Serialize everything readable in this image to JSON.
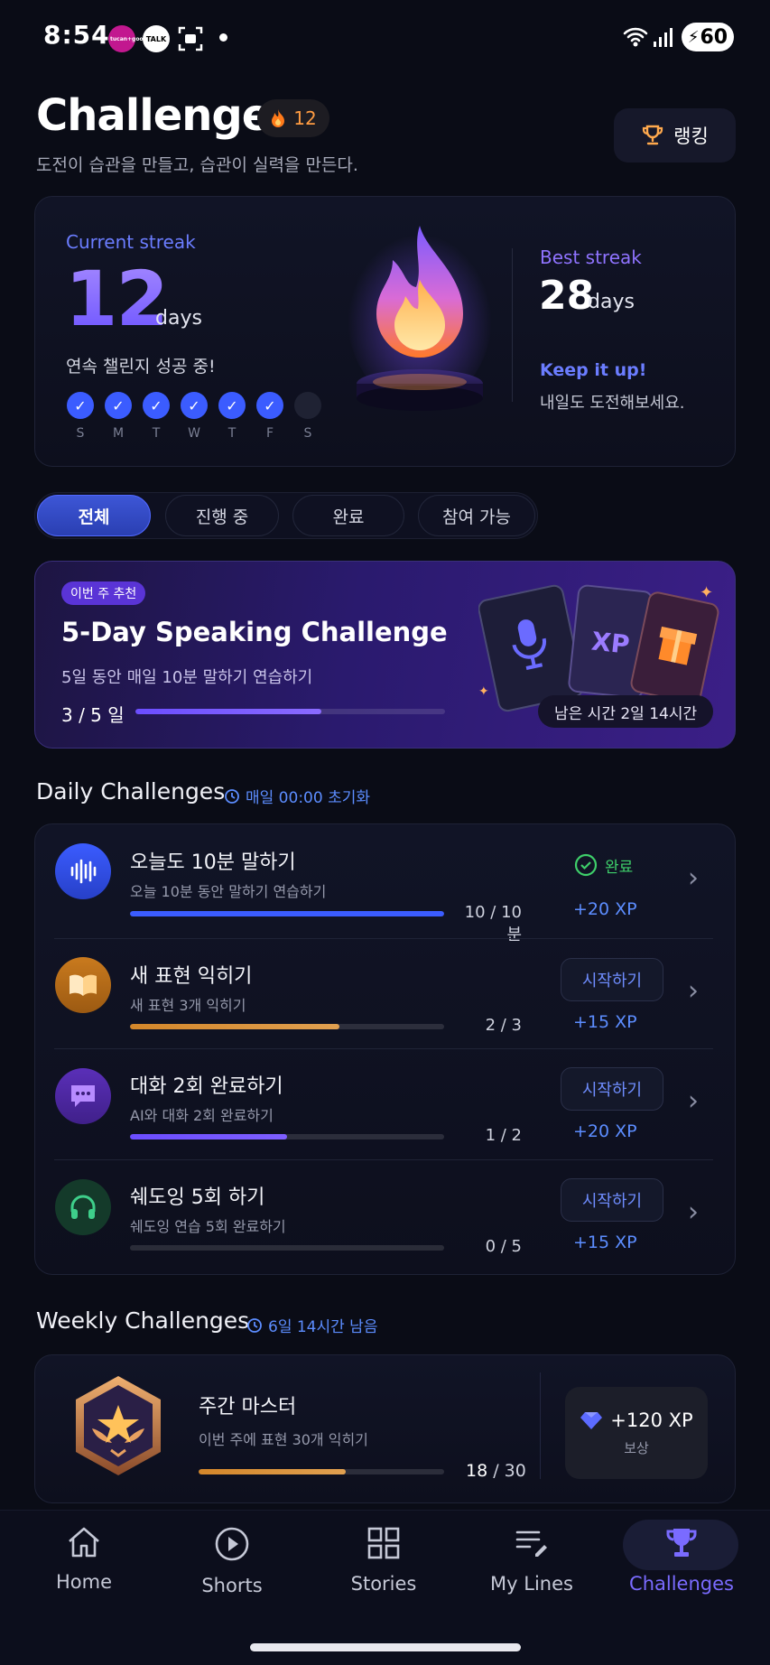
{
  "status_bar": {
    "time": "8:54",
    "apps": [
      "tucan+good",
      "TALK"
    ],
    "battery": "60"
  },
  "header": {
    "title": "Challenges",
    "streak_chip": "12",
    "subtitle": "도전이 습관을 만들고, 습관이 실력을 만든다.",
    "ranking_label": "랭킹"
  },
  "streak": {
    "current_label": "Current streak",
    "current_value": "12",
    "days_unit": "days",
    "current_sub": "연속 챌린지 성공 중!",
    "week": [
      {
        "letter": "S",
        "done": true
      },
      {
        "letter": "M",
        "done": true
      },
      {
        "letter": "T",
        "done": true
      },
      {
        "letter": "W",
        "done": true
      },
      {
        "letter": "T",
        "done": true
      },
      {
        "letter": "F",
        "done": true
      },
      {
        "letter": "S",
        "done": false
      }
    ],
    "best_label": "Best streak",
    "best_value": "28",
    "keep_title": "Keep it up!",
    "keep_sub": "내일도 도전해보세요."
  },
  "tabs": [
    "전체",
    "진행 중",
    "완료",
    "참여 가능"
  ],
  "featured": {
    "badge": "이번 주 추천",
    "title": "5-Day Speaking Challenge",
    "subtitle": "5일 동안 매일 10분 말하기 연습하기",
    "progress_label": "3 / 5 일",
    "progress": 0.6,
    "remaining": "남은 시간 2일 14시간",
    "card_xp": "XP"
  },
  "daily": {
    "title": "Daily Challenges",
    "reset_note": "매일 00:00 초기화",
    "items": [
      {
        "title": "오늘도 10분 말하기",
        "sub": "오늘 10분 동안 말하기 연습하기",
        "count": "10 / 10 분",
        "progress": 1.0,
        "status": "완료",
        "xp": "+20 XP"
      },
      {
        "title": "새 표현 익히기",
        "sub": "새 표현 3개 익히기",
        "count": "2 / 3",
        "progress": 0.6667,
        "action": "시작하기",
        "xp": "+15 XP"
      },
      {
        "title": "대화 2회 완료하기",
        "sub": "AI와 대화 2회 완료하기",
        "count": "1 / 2",
        "progress": 0.5,
        "action": "시작하기",
        "xp": "+20 XP"
      },
      {
        "title": "쉐도잉 5회 하기",
        "sub": "쉐도잉 연습 5회 완료하기",
        "count": "0 / 5",
        "progress": 0.0,
        "action": "시작하기",
        "xp": "+15 XP"
      }
    ]
  },
  "weekly": {
    "title": "Weekly Challenges",
    "remaining_note": "6일 14시간 남음",
    "item": {
      "title": "주간 마스터",
      "sub": "이번 주에 표현 30개 익히기",
      "count_done": "18",
      "count_total": "/ 30",
      "progress": 0.6,
      "reward_xp": "+120 XP",
      "reward_label": "보상"
    }
  },
  "nav": [
    {
      "label": "Home",
      "icon": "home-icon"
    },
    {
      "label": "Shorts",
      "icon": "play-icon"
    },
    {
      "label": "Stories",
      "icon": "grid-icon"
    },
    {
      "label": "My Lines",
      "icon": "edit-list-icon"
    },
    {
      "label": "Challenges",
      "icon": "trophy-icon",
      "active": true
    }
  ],
  "colors": {
    "background": "#0a0c16",
    "accent_blue": "#3b5cff",
    "accent_purple": "#7a6bff",
    "success": "#3ecf6a",
    "xp_blue": "#5c8dff"
  }
}
